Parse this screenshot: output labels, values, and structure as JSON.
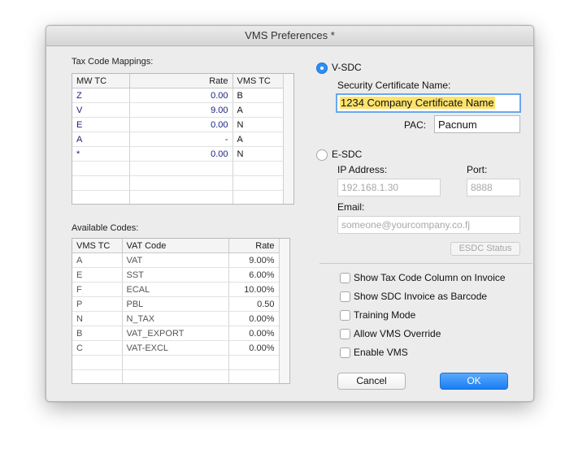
{
  "window": {
    "title": "VMS Preferences *"
  },
  "tax_code_mappings": {
    "label": "Tax Code Mappings:",
    "columns": [
      "MW TC",
      "Rate",
      "VMS TC"
    ],
    "rows": [
      [
        "Z",
        "0.00",
        "B"
      ],
      [
        "V",
        "9.00",
        "A"
      ],
      [
        "E",
        "0.00",
        "N"
      ],
      [
        "A",
        "-",
        "A"
      ],
      [
        "*",
        "0.00",
        "N"
      ]
    ]
  },
  "available_codes": {
    "label": "Available Codes:",
    "columns": [
      "VMS TC",
      "VAT Code",
      "Rate"
    ],
    "rows": [
      [
        "A",
        "VAT",
        "9.00%"
      ],
      [
        "E",
        "SST",
        "6.00%"
      ],
      [
        "F",
        "ECAL",
        "10.00%"
      ],
      [
        "P",
        "PBL",
        "0.50"
      ],
      [
        "N",
        "N_TAX",
        "0.00%"
      ],
      [
        "B",
        "VAT_EXPORT",
        "0.00%"
      ],
      [
        "C",
        "VAT-EXCL",
        "0.00%"
      ]
    ]
  },
  "vsdc": {
    "label": "V-SDC",
    "selected": true,
    "cert_label": "Security Certificate Name:",
    "cert_value": "1234 Company Certificate Name",
    "pac_label": "PAC:",
    "pac_value": "Pacnum"
  },
  "esdc": {
    "label": "E-SDC",
    "selected": false,
    "ip_label": "IP Address:",
    "ip_placeholder": "192.168.1.30",
    "port_label": "Port:",
    "port_placeholder": "8888",
    "email_label": "Email:",
    "email_placeholder": "someone@yourcompany.co.fj",
    "status_button": "ESDC Status"
  },
  "options": [
    {
      "label": "Show Tax Code Column on Invoice",
      "checked": false
    },
    {
      "label": "Show SDC Invoice as Barcode",
      "checked": false
    },
    {
      "label": "Training Mode",
      "checked": false
    },
    {
      "label": "Allow VMS Override",
      "checked": false
    },
    {
      "label": "Enable VMS",
      "checked": false
    }
  ],
  "buttons": {
    "cancel": "Cancel",
    "ok": "OK"
  },
  "colors": {
    "accent": "#2d8ef5",
    "highlight": "#fde36b"
  }
}
